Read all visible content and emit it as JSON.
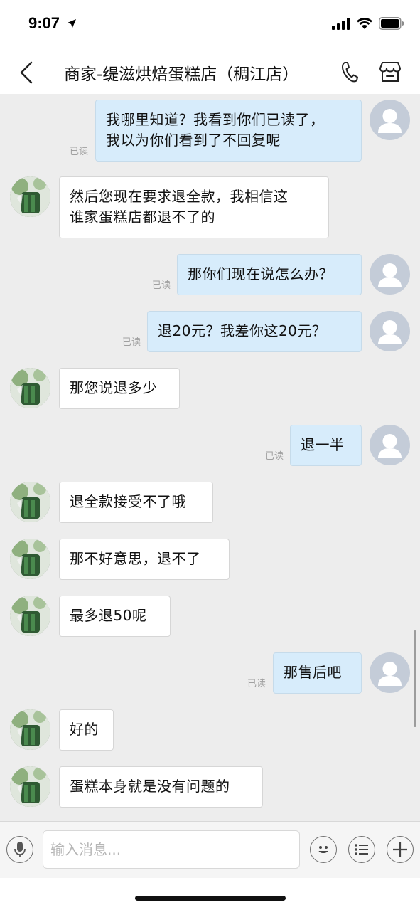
{
  "status_bar": {
    "time": "9:07"
  },
  "nav": {
    "title": "商家-缇滋烘焙蛋糕店（稠江店）"
  },
  "read_label": "已读",
  "messages": [
    {
      "direction": "out",
      "lines": [
        "我哪里知道？我看到你们已读了，",
        "我以为你们看到了不回复呢"
      ],
      "read": true
    },
    {
      "direction": "in",
      "lines": [
        "然后您现在要求退全款，我相信这",
        "谁家蛋糕店都退不了的"
      ]
    },
    {
      "direction": "out",
      "lines": [
        "那你们现在说怎么办？"
      ],
      "read": true
    },
    {
      "direction": "out",
      "lines": [
        "退20元？我差你这20元？"
      ],
      "read": true
    },
    {
      "direction": "in",
      "lines": [
        "那您说退多少"
      ]
    },
    {
      "direction": "out",
      "lines": [
        "退一半"
      ],
      "read": true
    },
    {
      "direction": "in",
      "lines": [
        "退全款接受不了哦"
      ]
    },
    {
      "direction": "in",
      "lines": [
        "那不好意思，退不了"
      ]
    },
    {
      "direction": "in",
      "lines": [
        "最多退50呢"
      ]
    },
    {
      "direction": "out",
      "lines": [
        "那售后吧"
      ],
      "read": true
    },
    {
      "direction": "in",
      "lines": [
        "好的"
      ]
    },
    {
      "direction": "in",
      "lines": [
        "蛋糕本身就是没有问题的"
      ]
    }
  ],
  "input": {
    "placeholder": "输入消息..."
  },
  "icons": {
    "back": "chevron-left-icon",
    "phone": "phone-icon",
    "shop": "shop-icon",
    "voice": "microphone-icon",
    "emoji": "emoji-icon",
    "menu": "list-menu-icon",
    "plus": "plus-icon"
  },
  "colors": {
    "chat_background": "#ededed",
    "outgoing_bubble": "#d7ecfb",
    "incoming_bubble": "#ffffff"
  }
}
